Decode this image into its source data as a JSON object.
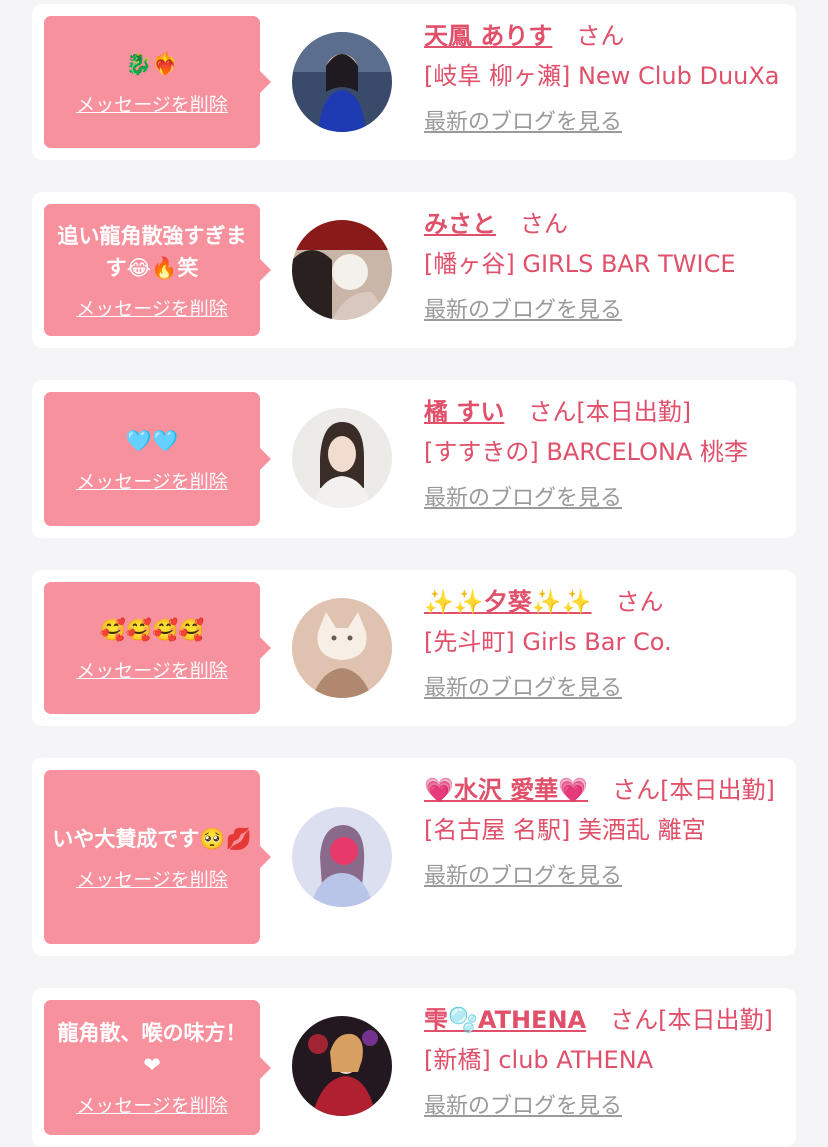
{
  "delete_label": "メッセージを削除",
  "blog_label": "最新のブログを見る",
  "colors": {
    "accent": "#e0506a",
    "bubble": "#f7919d",
    "link_gray": "#9a9a9a",
    "background": "#f5f5f7"
  },
  "items": [
    {
      "message": "🐉❤️‍🔥",
      "name": "天鳳 ありす",
      "suffix": "さん",
      "shop": "[岐阜 柳ヶ瀬] New Club DuuXa"
    },
    {
      "message": "追い龍角散強すぎます😂🔥笑",
      "name": "みさと",
      "suffix": "さん",
      "shop": "[幡ヶ谷] GIRLS BAR TWICE"
    },
    {
      "message": "🩵🩵",
      "name": "橘 すい",
      "suffix": "さん[本日出勤]",
      "shop": "[すすきの] BARCELONA 桃李"
    },
    {
      "message": "🥰🥰🥰🥰",
      "name": "✨✨夕葵✨✨",
      "suffix": "さん",
      "shop": "[先斗町] Girls Bar Co."
    },
    {
      "message": "いや大賛成です🥺💋",
      "name": "💗水沢 愛華💗",
      "suffix": "さん[本日出勤]",
      "shop": "[名古屋 名駅] 美酒乱 離宮"
    },
    {
      "message": "龍角散、喉の味方！❤",
      "name": "雫🫧ATHENA",
      "suffix": "さん[本日出勤]",
      "shop": "[新橋] club ATHENA"
    }
  ]
}
